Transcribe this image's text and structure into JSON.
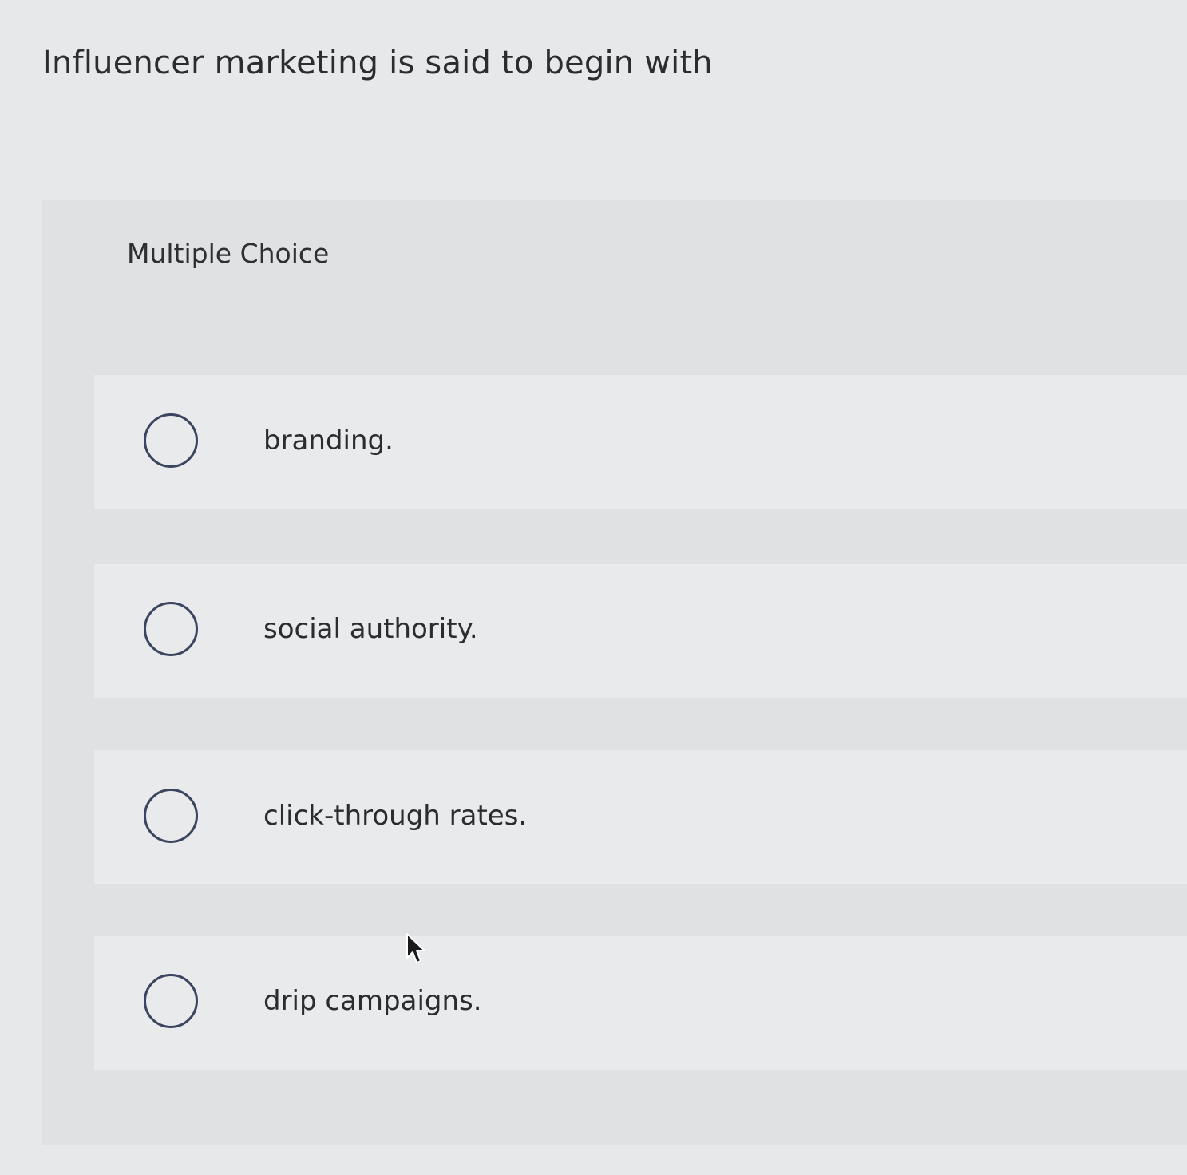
{
  "question": {
    "text": "Influencer marketing is said to begin with"
  },
  "multiple_choice": {
    "label": "Multiple Choice",
    "options": [
      {
        "label": "branding.",
        "selected": false
      },
      {
        "label": "social authority.",
        "selected": false
      },
      {
        "label": "click-through rates.",
        "selected": false
      },
      {
        "label": "drip campaigns.",
        "selected": false
      }
    ]
  },
  "cursor": {
    "icon": "arrow-pointer-icon"
  },
  "colors": {
    "page_background": "#e6e8e9",
    "panel_background": "#dfe1e3",
    "option_background": "#e8eaeb",
    "radio_border": "#3b4560",
    "text": "#2a2c2f"
  }
}
